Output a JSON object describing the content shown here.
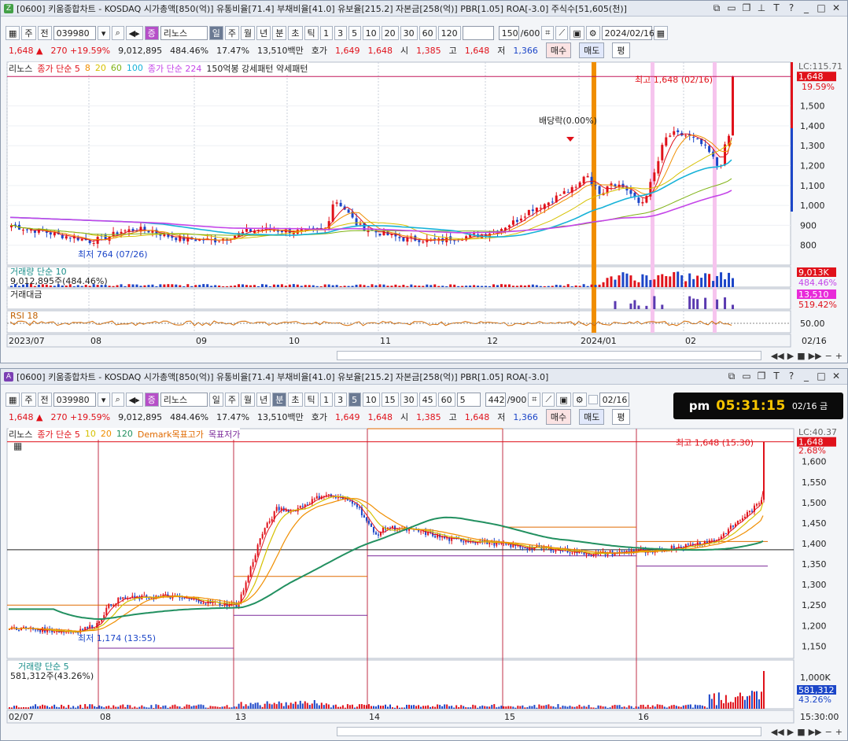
{
  "chart_data": [
    {
      "type": "candlestick",
      "period": "daily",
      "ylim": [
        700,
        1720
      ],
      "y_ticks": [
        800,
        900,
        1000,
        1100,
        1200,
        1300,
        1400,
        1500,
        1648
      ],
      "x_labels": [
        "2023/07",
        "08",
        "09",
        "10",
        "11",
        "12",
        "2024/01",
        "02",
        "02/16"
      ],
      "annotations": [
        "최고 1,648 (02/16)",
        "최저 764 (07/26)",
        "배당락(0.00%)"
      ],
      "close_points": [
        [
          0,
          900
        ],
        [
          20,
          880
        ],
        [
          40,
          870
        ],
        [
          60,
          850
        ],
        [
          80,
          840
        ],
        [
          100,
          820
        ],
        [
          120,
          838
        ],
        [
          140,
          870
        ],
        [
          160,
          880
        ],
        [
          180,
          870
        ],
        [
          200,
          845
        ],
        [
          220,
          830
        ],
        [
          240,
          828
        ],
        [
          260,
          825
        ],
        [
          280,
          845
        ],
        [
          300,
          870
        ],
        [
          320,
          880
        ],
        [
          340,
          875
        ],
        [
          360,
          870
        ],
        [
          380,
          870
        ],
        [
          400,
          880
        ],
        [
          410,
          1030
        ],
        [
          420,
          1000
        ],
        [
          440,
          900
        ],
        [
          460,
          870
        ],
        [
          480,
          850
        ],
        [
          500,
          830
        ],
        [
          520,
          830
        ],
        [
          540,
          820
        ],
        [
          560,
          835
        ],
        [
          580,
          845
        ],
        [
          600,
          855
        ],
        [
          620,
          880
        ],
        [
          640,
          920
        ],
        [
          660,
          980
        ],
        [
          680,
          1010
        ],
        [
          700,
          1060
        ],
        [
          720,
          1090
        ],
        [
          730,
          1170
        ],
        [
          740,
          1100
        ],
        [
          750,
          1060
        ],
        [
          760,
          1120
        ],
        [
          780,
          1090
        ],
        [
          800,
          1000
        ],
        [
          810,
          1080
        ],
        [
          820,
          1190
        ],
        [
          830,
          1330
        ],
        [
          840,
          1360
        ],
        [
          860,
          1350
        ],
        [
          880,
          1300
        ],
        [
          890,
          1250
        ],
        [
          900,
          1180
        ],
        [
          910,
          1340
        ],
        [
          920,
          1380
        ],
        [
          930,
          1648
        ]
      ],
      "series": [
        {
          "name": "5",
          "color": "#e0111a"
        },
        {
          "name": "8",
          "color": "#f08e00"
        },
        {
          "name": "20",
          "color": "#d6c100"
        },
        {
          "name": "60",
          "color": "#7fb214"
        },
        {
          "name": "100",
          "color": "#17b2d8"
        },
        {
          "name": "224",
          "color": "#c445e8"
        }
      ]
    },
    {
      "type": "bar",
      "name": "거래량",
      "values_label": "9,012,895주(484.46%)"
    },
    {
      "type": "bar",
      "name": "거래대금",
      "values_label": "13,510"
    },
    {
      "type": "line",
      "name": "RSI 18",
      "y_ticks": [
        50
      ]
    },
    {
      "type": "candlestick",
      "period": "5min",
      "ylim": [
        1120,
        1680
      ],
      "y_ticks": [
        1150,
        1200,
        1250,
        1300,
        1350,
        1400,
        1450,
        1500,
        1550,
        1600
      ],
      "x_labels": [
        "02/07",
        "08",
        "13",
        "14",
        "15",
        "16",
        "15:30:00"
      ],
      "annotations": [
        "최고 1,648 (15:30)",
        "최저 1,174 (13:55)"
      ],
      "close_points": [
        [
          0,
          1195
        ],
        [
          40,
          1190
        ],
        [
          80,
          1185
        ],
        [
          110,
          1200
        ],
        [
          125,
          1245
        ],
        [
          140,
          1265
        ],
        [
          200,
          1272
        ],
        [
          260,
          1255
        ],
        [
          290,
          1250
        ],
        [
          300,
          1300
        ],
        [
          320,
          1420
        ],
        [
          340,
          1485
        ],
        [
          360,
          1480
        ],
        [
          400,
          1520
        ],
        [
          440,
          1500
        ],
        [
          465,
          1420
        ],
        [
          480,
          1440
        ],
        [
          520,
          1430
        ],
        [
          560,
          1410
        ],
        [
          600,
          1405
        ],
        [
          640,
          1395
        ],
        [
          660,
          1390
        ],
        [
          700,
          1385
        ],
        [
          740,
          1375
        ],
        [
          780,
          1378
        ],
        [
          800,
          1385
        ],
        [
          815,
          1375
        ],
        [
          840,
          1390
        ],
        [
          860,
          1395
        ],
        [
          900,
          1410
        ],
        [
          930,
          1460
        ],
        [
          955,
          1500
        ],
        [
          970,
          1648
        ]
      ]
    },
    {
      "type": "bar",
      "name": "거래량 단순 5",
      "values_label": "581,312주(43.26%)"
    }
  ],
  "top": {
    "title": "[0600] 키움종합차트 - KOSDAQ 시가총액[850(억)] 유통비율[71.4] 부채비율[41.0] 유보율[215.2] 자본금[258(억)] PBR[1.05] ROA[-3.0] 주식수[51,605(천)]",
    "code": "039980",
    "name": "리노스",
    "count": "150",
    "total": "/600",
    "date": "2024/02/16",
    "last_price": "1,648",
    "change": "270",
    "change_pct": "+19.59%",
    "volume": "9,012,895",
    "vol_ratio": "484.46%",
    "turnover": "17.47%",
    "amount": "13,510백만",
    "hoga_label": "호가",
    "ask": "1,649",
    "bid": "1,648",
    "open_label": "시",
    "open": "1,385",
    "high_label": "고",
    "high": "1,648",
    "low_label": "저",
    "low": "1,366",
    "buy": "매수",
    "sell": "매도",
    "flat": "평",
    "legend_name": "리노스",
    "legend_ma1": "종가 단순 5",
    "legend_ma_extra": [
      "8",
      "20",
      "60",
      "100"
    ],
    "legend_ma2": "종가 단순 224",
    "legend_pat": "150억봉 강세패턴 약세패턴",
    "price_tag": "1,648",
    "pct_tag": "19.59%",
    "lc_tag": "LC:115.71",
    "vol_label": "거래량 단순 10",
    "vol_value": "9,012,895주(484.46%)",
    "vol_tag": "9,013K",
    "vol_pct_tag": "484.46%",
    "amt_label": "거래대금",
    "amt_tag": "13,510",
    "amt_pct_tag": "519.42%",
    "rsi_label": "RSI 18",
    "rsi_tick": "50.00"
  },
  "bottom": {
    "title": "[0600] 키움종합차트 - KOSDAQ 시가총액[850(억)] 유통비율[71.4] 부채비율[41.0] 유보율[215.2] 자본금[258(억)] PBR[1.05] ROA[-3.0]",
    "code": "039980",
    "name": "리노스",
    "minute": "5",
    "count": "442",
    "total": "/900",
    "date": "02/16",
    "legend_ma": "종가 단순",
    "legend_ma_vals": [
      "5",
      "10",
      "20",
      "120"
    ],
    "legend_demark": "Demark목표고가",
    "legend_demark2": "목표저가",
    "price_tag": "1,648",
    "pct_tag": "2.68%",
    "lc_tag": "LC:40.37",
    "vol_label": "거래량 단순 5",
    "vol_value": "581,312주(43.26%)",
    "vol_tag": "581,312",
    "vol_pct_tag": "43.26%",
    "vol_tick": "1,000K"
  },
  "buttons": {
    "ju": "주",
    "jeon": "전",
    "il": "일",
    "ju2": "주",
    "wol": "월",
    "nyeon": "년",
    "bun": "분",
    "cho": "초",
    "tik": "틱",
    "n1": "1",
    "n3": "3",
    "n5": "5",
    "n10": "10",
    "n15": "15",
    "n20": "20",
    "n30": "30",
    "n45": "45",
    "n60": "60",
    "n120": "120"
  },
  "clock": {
    "ampm": "pm",
    "time": "05:31:15",
    "date": "02/16 금"
  },
  "colors": {
    "up": "#e0111a",
    "down": "#1c46c8",
    "ma224": "#c445e8",
    "ma120": "#229060",
    "highlight": "#f08e00"
  }
}
